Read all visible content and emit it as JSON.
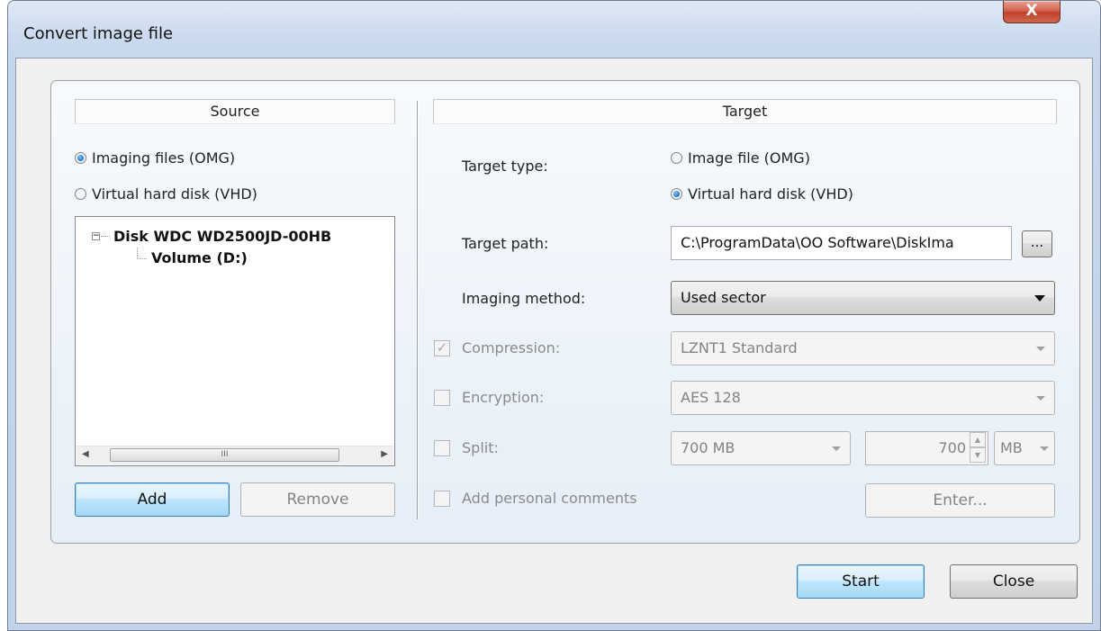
{
  "window": {
    "title": "Convert image file",
    "close_glyph": "X"
  },
  "source": {
    "header": "Source",
    "radio_imaging_files": "Imaging files (OMG)",
    "radio_virtual_hard_disk": "Virtual hard disk (VHD)",
    "selected": "Imaging files (OMG)",
    "tree": {
      "disk_label": "Disk WDC WD2500JD-00HB",
      "volume_label": "Volume (D:)",
      "expander_glyph": "−",
      "scroll_thumb_glyph": "III"
    },
    "add_label": "Add",
    "remove_label": "Remove"
  },
  "target": {
    "header": "Target",
    "target_type_label": "Target type:",
    "radio_image_file": "Image file (OMG)",
    "radio_virtual_hard_disk": "Virtual hard disk (VHD)",
    "selected": "Virtual hard disk (VHD)",
    "target_path_label": "Target path:",
    "target_path_value": "C:\\ProgramData\\OO Software\\DiskIma",
    "browse_label": "...",
    "imaging_method_label": "Imaging method:",
    "imaging_method_value": "Used sector",
    "compression_label": "Compression:",
    "compression_checked": true,
    "compression_value": "LZNT1 Standard",
    "encryption_label": "Encryption:",
    "encryption_checked": false,
    "encryption_value": "AES 128",
    "split_label": "Split:",
    "split_checked": false,
    "split_size_value": "700 MB",
    "split_custom_value": "700",
    "split_unit_value": "MB",
    "comments_label": "Add personal comments",
    "comments_checked": false,
    "enter_label": "Enter..."
  },
  "footer": {
    "start_label": "Start",
    "close_label": "Close"
  },
  "colors": {
    "accent": "#3c7fb1",
    "title_bar": "#c6d7ec",
    "close_button": "#c1402a"
  }
}
